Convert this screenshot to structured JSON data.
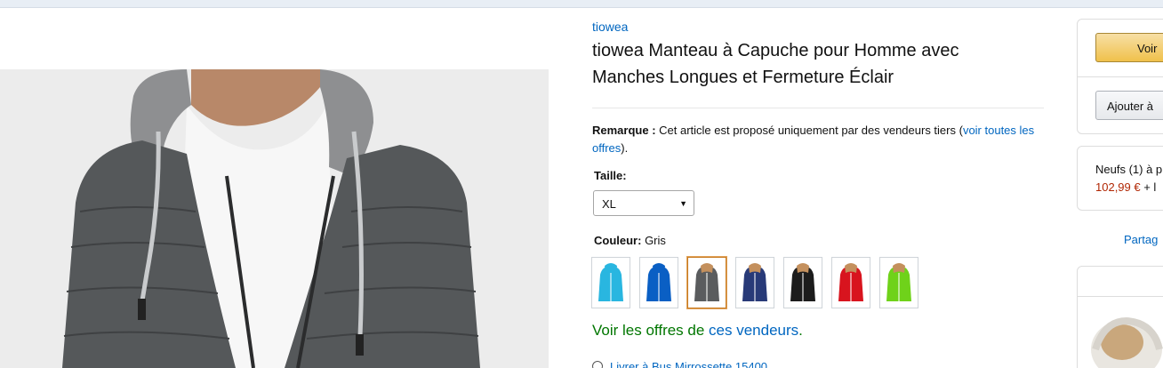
{
  "product": {
    "brand": "tiowea",
    "title": "tiowea Manteau à Capuche pour Homme avec Manches Longues et Fermeture Éclair",
    "main_image_icon": "jacket-photo",
    "note": {
      "label": "Remarque :",
      "text": " Cet article est proposé uniquement par des vendeurs tiers (",
      "link": "voir toutes les offres",
      "end": ")."
    },
    "size": {
      "label": "Taille:",
      "selected": "XL"
    },
    "color": {
      "label": "Couleur:",
      "selected": " Gris",
      "swatches": [
        {
          "name": "cyan",
          "color": "#29b6e0"
        },
        {
          "name": "bleu",
          "color": "#0a5fc4"
        },
        {
          "name": "gris",
          "color": "#5a5c5e"
        },
        {
          "name": "marine",
          "color": "#283a78"
        },
        {
          "name": "noir",
          "color": "#1c1c1c"
        },
        {
          "name": "rouge",
          "color": "#d8141e"
        },
        {
          "name": "vert",
          "color": "#6fd21a"
        }
      ]
    },
    "offers": {
      "prefix": "Voir les offres de ",
      "link": "ces vendeurs",
      "suffix": "."
    },
    "delivery": "Livrer à Bus Mirrossette 15400"
  },
  "buybox": {
    "see_label": "Voir",
    "add_label": "Ajouter à",
    "new_text": "Neufs (1) à p",
    "new_price": "102,99 €",
    "new_price_suffix": " + l",
    "share": "Partag"
  },
  "colors": {
    "link": "#0066c0",
    "price": "#b12704",
    "offers_green": "#007600",
    "selected_swatch": "#c77b21"
  }
}
